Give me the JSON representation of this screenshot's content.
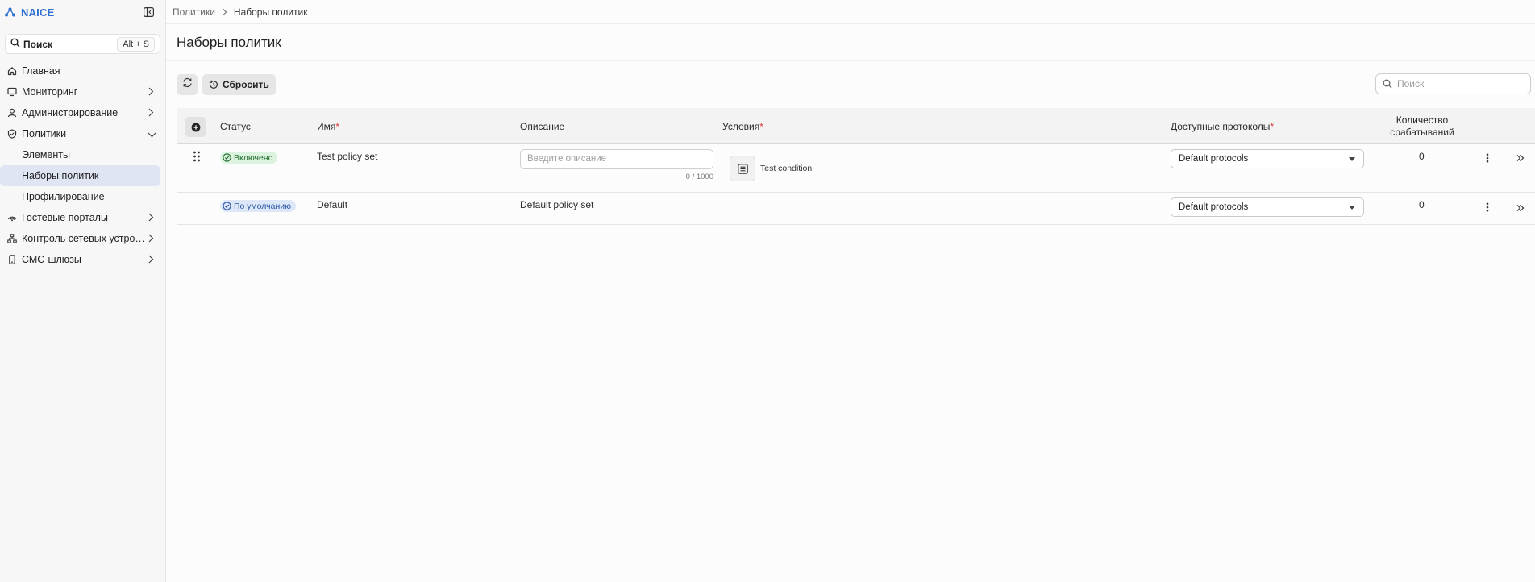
{
  "app": {
    "name": "NAICE"
  },
  "search": {
    "label": "Поиск",
    "shortcut": "Alt + S"
  },
  "sidebar": {
    "items": [
      {
        "label": "Главная",
        "icon": "home-icon"
      },
      {
        "label": "Мониторинг",
        "icon": "monitor-icon"
      },
      {
        "label": "Администрирование",
        "icon": "user-icon"
      },
      {
        "label": "Политики",
        "icon": "shield-icon",
        "children": [
          {
            "label": "Элементы"
          },
          {
            "label": "Наборы политик"
          },
          {
            "label": "Профилирование"
          }
        ]
      },
      {
        "label": "Гостевые порталы",
        "icon": "wifi-icon"
      },
      {
        "label": "Контроль сетевых устро…",
        "icon": "network-icon"
      },
      {
        "label": "СМС-шлюзы",
        "icon": "phone-icon"
      }
    ]
  },
  "breadcrumb": {
    "parent": "Политики",
    "current": "Наборы политик"
  },
  "page": {
    "title": "Наборы политик"
  },
  "toolbar": {
    "reset_label": "Сбросить",
    "search_placeholder": "Поиск"
  },
  "table": {
    "headers": {
      "status": "Статус",
      "name": "Имя",
      "description": "Описание",
      "conditions": "Условия",
      "protocols": "Доступные протоколы",
      "count_line1": "Количество",
      "count_line2": "срабатываний",
      "required_mark": "*"
    },
    "rows": [
      {
        "status": "Включено",
        "name": "Test policy set",
        "description_placeholder": "Введите описание",
        "description_counter": "0 / 1000",
        "condition": "Test condition",
        "protocol": "Default protocols",
        "count": "0"
      },
      {
        "status": "По умолчанию",
        "name": "Default",
        "description": "Default policy set",
        "protocol": "Default protocols",
        "count": "0"
      }
    ]
  },
  "colors": {
    "accent": "#2f6fd1",
    "active_nav": "#dfe5f3",
    "enabled_badge": "#dcf3df",
    "default_badge": "#dde7f7",
    "required": "#dd3333"
  }
}
